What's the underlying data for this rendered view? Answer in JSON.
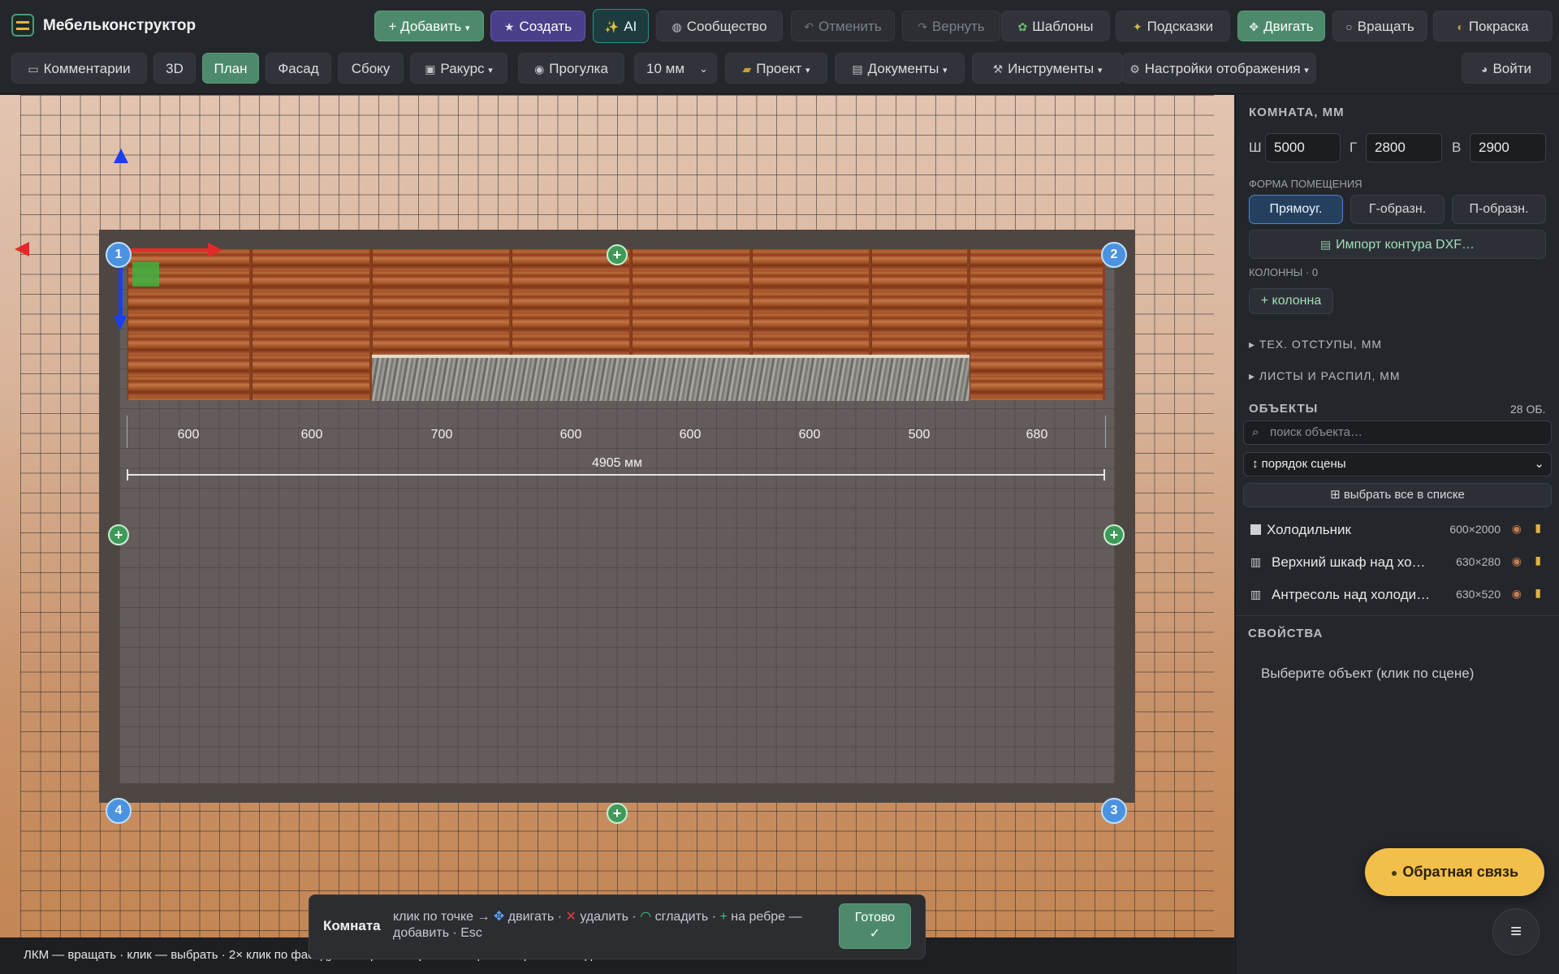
{
  "app": {
    "title": "Мебельконструктор"
  },
  "toolbar1": {
    "add": "+ Добавить",
    "add_caret": "▾",
    "create": "Создать",
    "ai": "AI",
    "community": "Сообщество",
    "undo": "Отменить",
    "redo": "Вернуть",
    "templates": "Шаблоны",
    "hints": "Подсказки",
    "move": "Двигать",
    "rotate": "Вращать",
    "paint": "Покраска"
  },
  "toolbar2": {
    "comments": "Комментарии",
    "v3d": "3D",
    "plan": "План",
    "facade": "Фасад",
    "side": "Сбоку",
    "angle": "Ракурс",
    "walk": "Прогулка",
    "step": "10 мм",
    "project": "Проект",
    "docs": "Документы",
    "tools": "Инструменты",
    "display": "Настройки отображения",
    "login": "Войти",
    "caret": "▾"
  },
  "scene": {
    "corners": [
      "1",
      "2",
      "3",
      "4"
    ],
    "cabinet_widths": [
      "600",
      "600",
      "700",
      "600",
      "600",
      "600",
      "500",
      "680"
    ],
    "total": "4905 мм"
  },
  "panel": {
    "room_heading": "КОМНАТА, ММ",
    "w_label": "Ш",
    "w": "5000",
    "d_label": "Г",
    "d": "2800",
    "h_label": "В",
    "h": "2900",
    "shape_heading": "ФОРМА ПОМЕЩЕНИЯ",
    "shapes": [
      "Прямоуг.",
      "Г-образн.",
      "П-образн."
    ],
    "import": "Импорт контура DXF…",
    "columns": "КОЛОННЫ · 0",
    "add_column": "+ колонна",
    "tech": "ТЕХ. ОТСТУПЫ, ММ",
    "sheets": "ЛИСТЫ И РАСПИЛ, ММ",
    "objects_heading": "ОБЪЕКТЫ",
    "objects_count": "28 ОБ.",
    "search_placeholder": "поиск объекта…",
    "order": "↕ порядок сцены",
    "select_all": "⊞ выбрать все в списке",
    "objects": [
      {
        "name": "Холодильник",
        "size": "600×2000"
      },
      {
        "name": "Верхний шкаф над хо…",
        "size": "630×280"
      },
      {
        "name": "Антресоль над холоди…",
        "size": "630×520"
      }
    ],
    "props_heading": "СВОЙСТВА",
    "props_hint": "Выберите объект (клик по сцене)"
  },
  "feedback": "Обратная связь",
  "status": "ЛКМ — вращать · клик — выбрать · 2× клик по фасаду — открыть/закрыть · тащить выбранный — двигать",
  "toast": {
    "title": "Комната",
    "p1": "клик по точке →",
    "move": "двигать",
    "delete": "удалить",
    "smooth": "сгладить",
    "edge": "на ребре —",
    "p2": "добавить · Esc",
    "done": "Готово",
    "check": "✓"
  }
}
